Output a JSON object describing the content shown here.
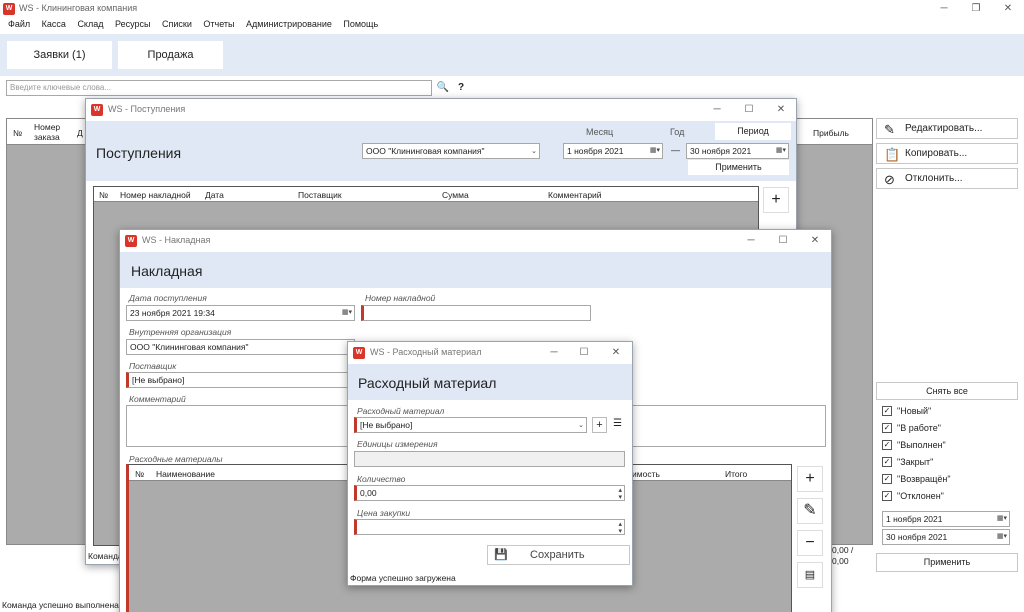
{
  "main": {
    "title": "WS - Клининговая компания",
    "menu": [
      "Файл",
      "Касса",
      "Склад",
      "Ресурсы",
      "Списки",
      "Отчеты",
      "Администрирование",
      "Помощь"
    ],
    "tabs": [
      "Заявки (1)",
      "Продажа"
    ],
    "search_placeholder": "Введите ключевые слова...",
    "search_icon": "magnifier-icon",
    "help": "?",
    "grid_headers": [
      "№",
      "Номер заказа",
      "Д",
      "Прибыль"
    ],
    "status": "Команда успешно выполнена",
    "bottom_values": [
      "0,00 /",
      "0,00"
    ]
  },
  "sidebar": {
    "actions": [
      {
        "label": "Редактировать...",
        "icon": "pencil-icon"
      },
      {
        "label": "Копировать...",
        "icon": "clipboard-icon"
      },
      {
        "label": "Отклонить...",
        "icon": "cancel-icon"
      }
    ],
    "clear_all": "Снять все",
    "statuses": [
      "\"Новый\"",
      "\"В работе\"",
      "\"Выполнен\"",
      "\"Закрыт\"",
      "\"Возвращён\"",
      "\"Отклонен\""
    ],
    "date_from": "1  ноября  2021",
    "date_to": "30  ноября  2021",
    "apply": "Применить"
  },
  "receipts": {
    "title": "WS - Поступления",
    "header": "Поступления",
    "org": "ООО \"Клининговая компания\"",
    "period_tabs": [
      "Месяц",
      "Год",
      "Период"
    ],
    "date_from": "1  ноября  2021",
    "dash": "—",
    "date_to": "30  ноября  2021",
    "apply": "Применить",
    "columns": [
      "№",
      "Номер накладной",
      "Дата",
      "Поставщик",
      "Сумма",
      "Комментарий"
    ],
    "status": "Команда"
  },
  "invoice": {
    "title": "WS - Накладная",
    "header": "Накладная",
    "date_label": "Дата поступления",
    "date_value": "23  ноября  2021 19:34",
    "number_label": "Номер накладной",
    "org_label": "Внутренняя организация",
    "org_value": "ООО \"Клининговая компания\"",
    "supplier_label": "Поставщик",
    "supplier_value": "[Не выбрано]",
    "comment_label": "Комментарий",
    "materials_label": "Расходные материалы",
    "columns": [
      "№",
      "Наименование",
      "имость",
      "Итого"
    ]
  },
  "material": {
    "title": "WS - Расходный материал",
    "header": "Расходный материал",
    "material_label": "Расходный материал",
    "material_value": "[Не выбрано]",
    "units_label": "Единицы измерения",
    "qty_label": "Количество",
    "qty_value": "0,00",
    "price_label": "Цена закупки",
    "save": "Сохранить",
    "status": "Форма успешно загружена"
  }
}
